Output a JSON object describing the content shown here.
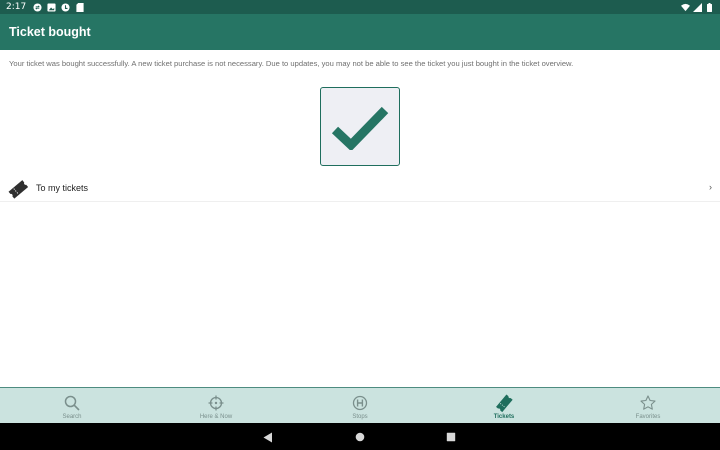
{
  "status_bar": {
    "time": "2:17",
    "icons_left": [
      "sync-icon",
      "image-icon",
      "info-icon",
      "sd-card-icon"
    ],
    "icons_right": [
      "wifi-icon",
      "signal-icon",
      "battery-icon"
    ]
  },
  "app_bar": {
    "title": "Ticket bought"
  },
  "main": {
    "message": "Your ticket was bought successfully. A new ticket purchase is not necessary. Due to updates, you may not be able to see the ticket you just bought in the ticket overview.",
    "success_icon": "checkmark-icon",
    "my_tickets_link": {
      "label": "To my tickets",
      "icon": "ticket-icon",
      "chevron": "›"
    }
  },
  "bottom_nav": {
    "items": [
      {
        "label": "Search",
        "icon": "search-icon",
        "active": false
      },
      {
        "label": "Here & Now",
        "icon": "crosshair-icon",
        "active": false
      },
      {
        "label": "Stops",
        "icon": "stop-sign-icon",
        "active": false
      },
      {
        "label": "Tickets",
        "icon": "ticket-icon",
        "active": true
      },
      {
        "label": "Favorites",
        "icon": "star-icon",
        "active": false
      }
    ]
  },
  "colors": {
    "status_bar": "#1d5c4f",
    "app_bar": "#267564",
    "accent": "#1f6e5d",
    "bottom_nav_bg": "#cbe3df",
    "nav_inactive": "#7a8f8c"
  }
}
